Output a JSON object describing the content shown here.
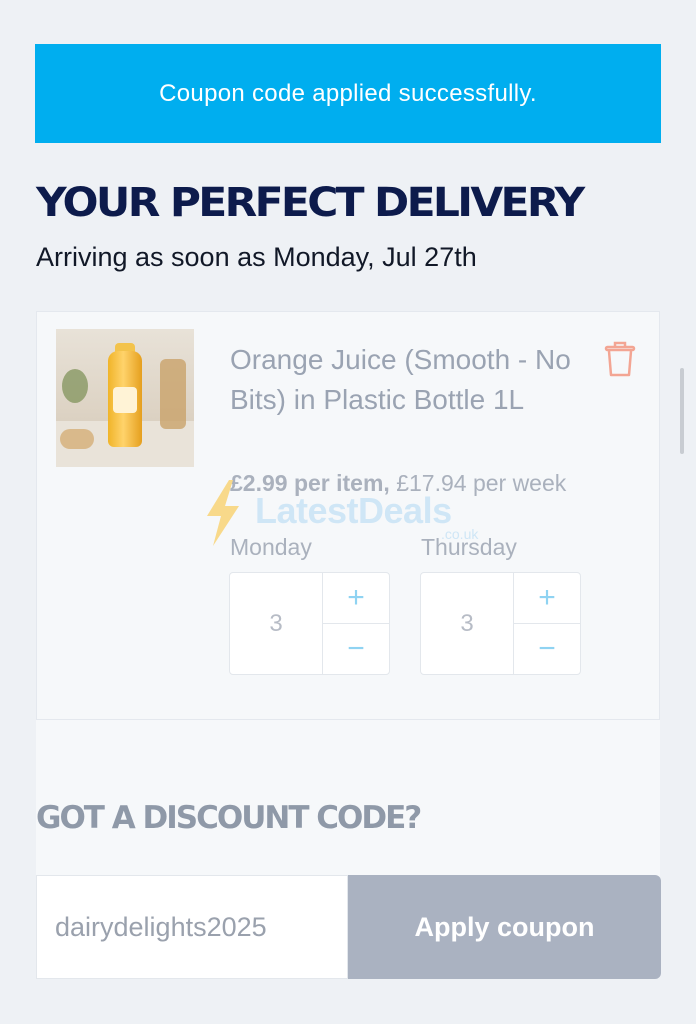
{
  "banner": {
    "message": "Coupon code applied successfully."
  },
  "header": {
    "title": "YOUR PERFECT DELIVERY",
    "arrival": "Arriving as soon as Monday, Jul 27th"
  },
  "product": {
    "name": "Orange Juice (Smooth - No Bits) in Plastic Bottle 1L",
    "price_per_item": "£2.99 per item,",
    "price_per_week": "£17.94 per week",
    "delete_icon": "trash-icon",
    "days": [
      {
        "label": "Monday",
        "quantity": "3",
        "plus": "+",
        "minus": "−"
      },
      {
        "label": "Thursday",
        "quantity": "3",
        "plus": "+",
        "minus": "−"
      }
    ]
  },
  "watermark": {
    "text": "LatestDeals",
    "sub": ".co.uk"
  },
  "discount": {
    "title": "GOT A DISCOUNT CODE?",
    "code_value": "dairydelights2025",
    "apply_label": "Apply coupon"
  },
  "colors": {
    "banner": "#00aeef",
    "title": "#0d1b4c",
    "trash": "#f3a593",
    "stepper_icons": "#8fd3f2",
    "apply_button": "#aab2c1"
  }
}
